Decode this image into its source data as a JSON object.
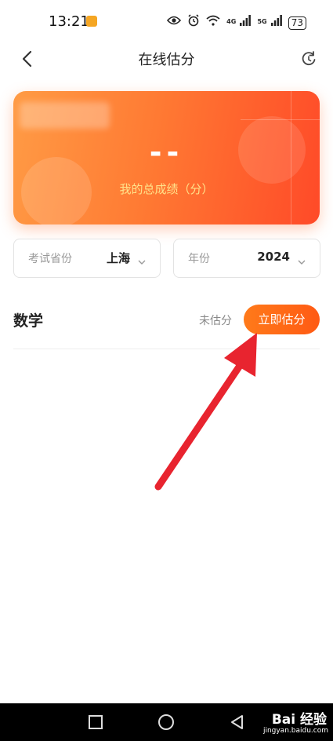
{
  "status_bar": {
    "time": "13:21",
    "signal_1": "4G",
    "signal_2": "5G",
    "battery": "73"
  },
  "nav": {
    "title": "在线估分",
    "back_icon": "chevron-left-icon",
    "refresh_icon": "refresh-icon"
  },
  "score_card": {
    "score": "--",
    "label": "我的总成绩（分）"
  },
  "filters": {
    "province_label": "考试省份",
    "province_value": "上海",
    "year_label": "年份",
    "year_value": "2024"
  },
  "subjects": [
    {
      "name": "数学",
      "status": "未估分",
      "action": "立即估分"
    }
  ],
  "colors": {
    "accent": "#ff6a1a",
    "card_start": "#ff9b45",
    "card_end": "#ff4a28",
    "arrow": "#e8242f"
  },
  "watermark": {
    "brand": "Bai 经验",
    "url": "jingyan.baidu.com"
  }
}
